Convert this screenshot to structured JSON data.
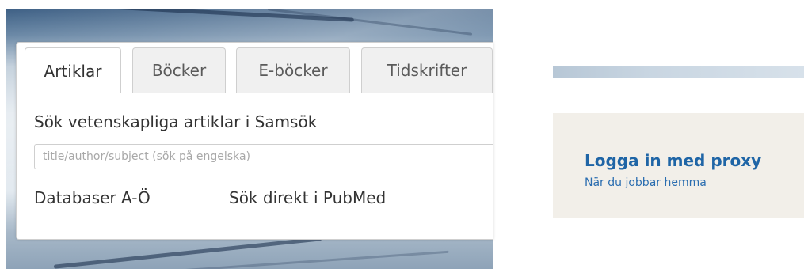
{
  "search": {
    "tabs": [
      {
        "label": "Artiklar",
        "active": true
      },
      {
        "label": "Böcker",
        "active": false
      },
      {
        "label": "E-böcker",
        "active": false
      },
      {
        "label": "Tidskrifter",
        "active": false
      }
    ],
    "heading": "Sök vetenskapliga artiklar i Samsök",
    "placeholder": "title/author/subject (sök på engelska)",
    "value": "",
    "links": [
      {
        "label": "Databaser A-Ö"
      },
      {
        "label": "Sök direkt i PubMed"
      }
    ]
  },
  "proxy": {
    "title": "Logga in med proxy",
    "subtitle": "När du jobbar hemma"
  },
  "colors": {
    "proxy_title": "#1f65a6",
    "proxy_background": "#f2efe9",
    "tab_inactive": "#f0f0f0"
  }
}
